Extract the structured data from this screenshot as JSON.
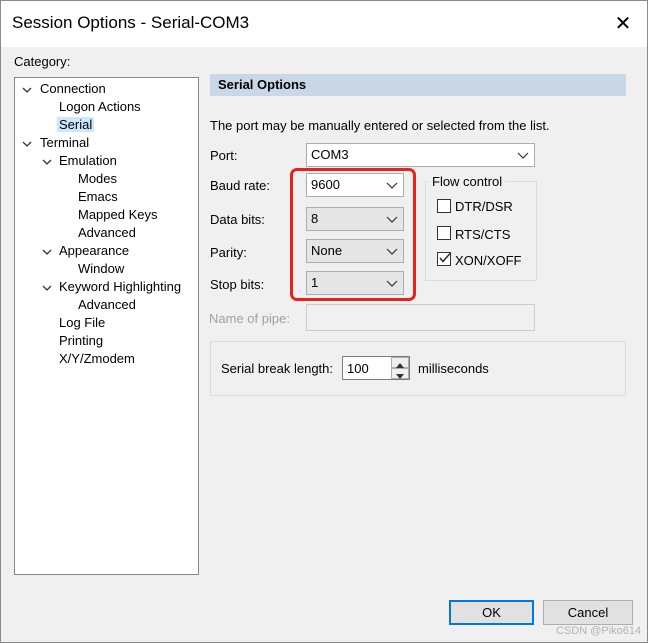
{
  "window": {
    "title": "Session Options - Serial-COM3",
    "close_glyph": "✕"
  },
  "category": {
    "label": "Category:",
    "tree": [
      {
        "label": "Connection",
        "expander": "∨"
      },
      {
        "label": "Logon Actions"
      },
      {
        "label": "Serial",
        "selected": true
      },
      {
        "label": "Terminal",
        "expander": "∨"
      },
      {
        "label": "Emulation",
        "expander": "∨"
      },
      {
        "label": "Modes"
      },
      {
        "label": "Emacs"
      },
      {
        "label": "Mapped Keys"
      },
      {
        "label": "Advanced"
      },
      {
        "label": "Appearance",
        "expander": "∨"
      },
      {
        "label": "Window"
      },
      {
        "label": "Keyword Highlighting",
        "expander": "∨"
      },
      {
        "label": "Advanced"
      },
      {
        "label": "Log File"
      },
      {
        "label": "Printing"
      },
      {
        "label": "X/Y/Zmodem"
      }
    ]
  },
  "panel": {
    "header": "Serial Options",
    "intro": "The port may be manually entered or selected from the list.",
    "port": {
      "label": "Port:",
      "value": "COM3"
    },
    "baud": {
      "label": "Baud rate:",
      "value": "9600"
    },
    "data_bits": {
      "label": "Data bits:",
      "value": "8"
    },
    "parity": {
      "label": "Parity:",
      "value": "None"
    },
    "stop_bits": {
      "label": "Stop bits:",
      "value": "1"
    },
    "pipe": {
      "label": "Name of pipe:",
      "value": ""
    },
    "flow": {
      "title": "Flow control",
      "dtr": {
        "label": "DTR/DSR",
        "checked": false
      },
      "rts": {
        "label": "RTS/CTS",
        "checked": false
      },
      "xon": {
        "label": "XON/XOFF",
        "checked": true,
        "check_glyph": "✓"
      }
    },
    "break": {
      "label": "Serial break length:",
      "value": "100",
      "unit": "milliseconds"
    }
  },
  "buttons": {
    "ok": "OK",
    "cancel": "Cancel"
  },
  "watermark": "CSDN @Piko614",
  "colors": {
    "highlight": "#e8231b",
    "selected": "#cce8ff",
    "header": "#c9d7e8",
    "default_button": "#0078d7"
  }
}
